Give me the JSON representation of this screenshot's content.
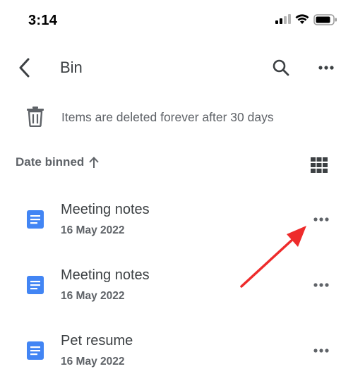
{
  "status_bar": {
    "time": "3:14",
    "icons": [
      "cellular-signal-icon",
      "wifi-icon",
      "battery-icon"
    ]
  },
  "app_bar": {
    "title": "Bin",
    "icons": [
      "back-chevron-icon",
      "search-icon",
      "more-horizontal-icon"
    ]
  },
  "info_banner": {
    "text": "Items are deleted forever after 30 days",
    "icon": "trash-icon"
  },
  "sort": {
    "label": "Date binned",
    "direction_icon": "arrow-up-icon",
    "view_toggle_icon": "grid-view-icon"
  },
  "files": [
    {
      "name": "Meeting notes",
      "date": "16 May 2022",
      "icon": "docs-icon"
    },
    {
      "name": "Meeting notes",
      "date": "16 May 2022",
      "icon": "docs-icon"
    },
    {
      "name": "Pet resume",
      "date": "16 May 2022",
      "icon": "docs-icon"
    }
  ],
  "colors": {
    "docs_blue": "#4285f4",
    "annotation_red": "#ee2b2b",
    "text_primary": "#3c4043",
    "text_secondary": "#5f6368"
  }
}
